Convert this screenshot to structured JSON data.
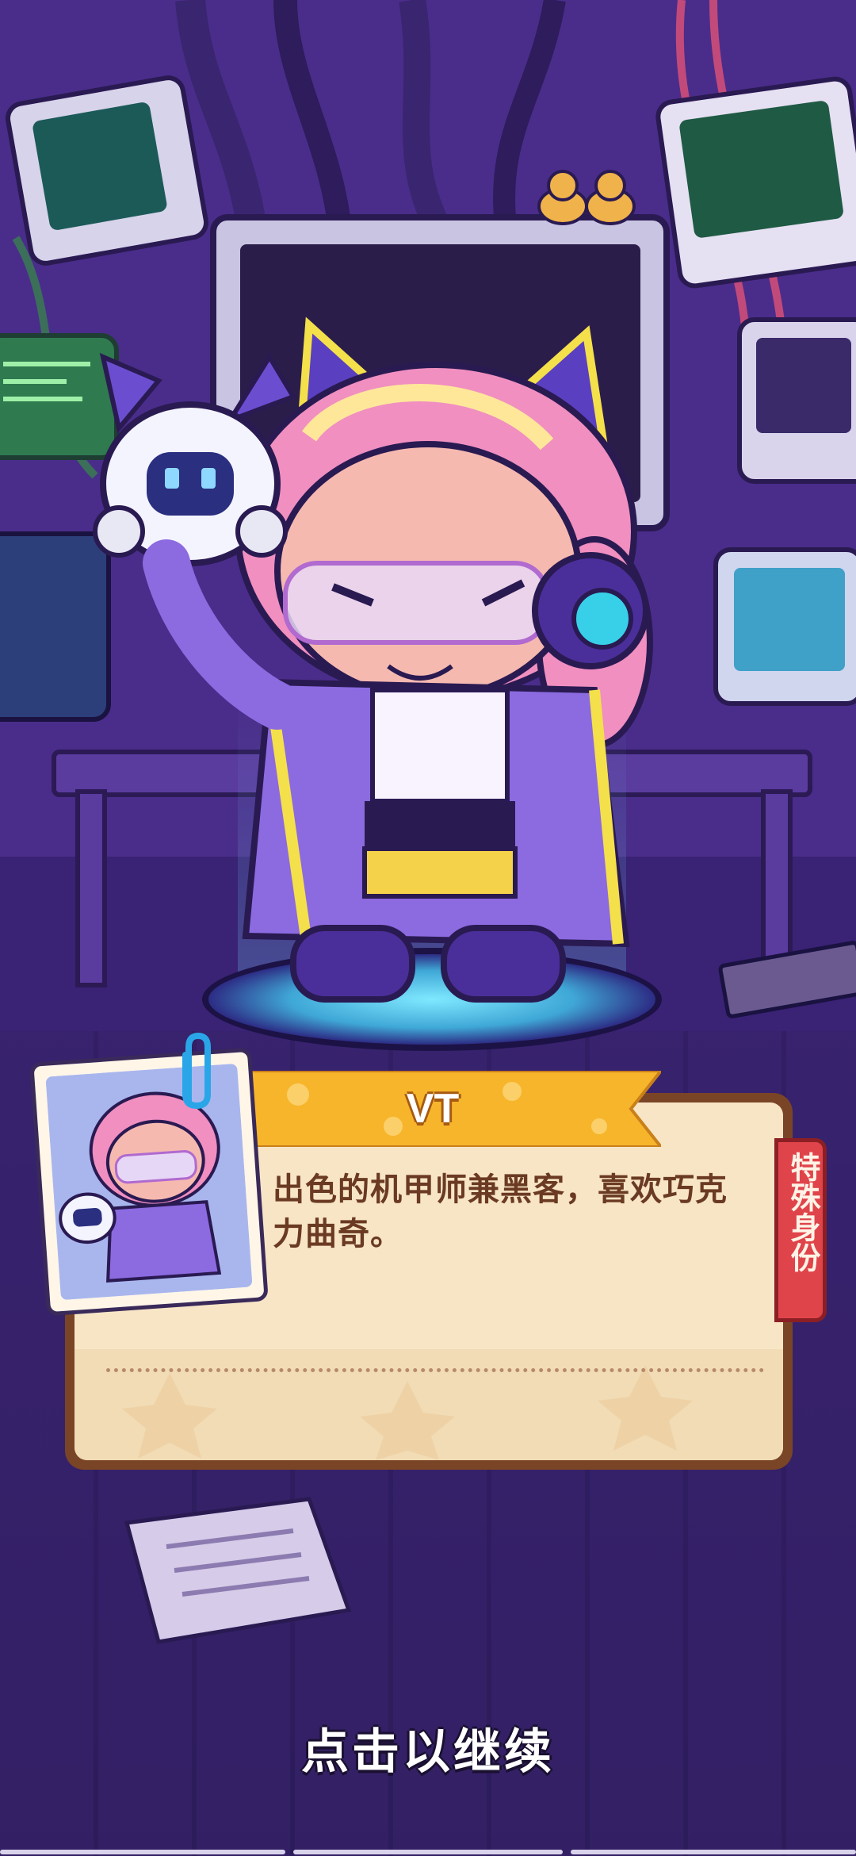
{
  "character": {
    "name": "VT",
    "description": "出色的机甲师兼黑客，喜欢巧克力曲奇。",
    "tag": "特殊身份"
  },
  "prompt": {
    "continue_label": "点击以继续"
  },
  "icons": [
    "paperclip-icon"
  ],
  "colors": {
    "ribbon": "#f7b52b",
    "tag": "#e0444b",
    "dialog_border": "#7a4526",
    "dialog_fill": "#f7e5c6",
    "description_text": "#6b3a22",
    "background": "#3d2478"
  }
}
